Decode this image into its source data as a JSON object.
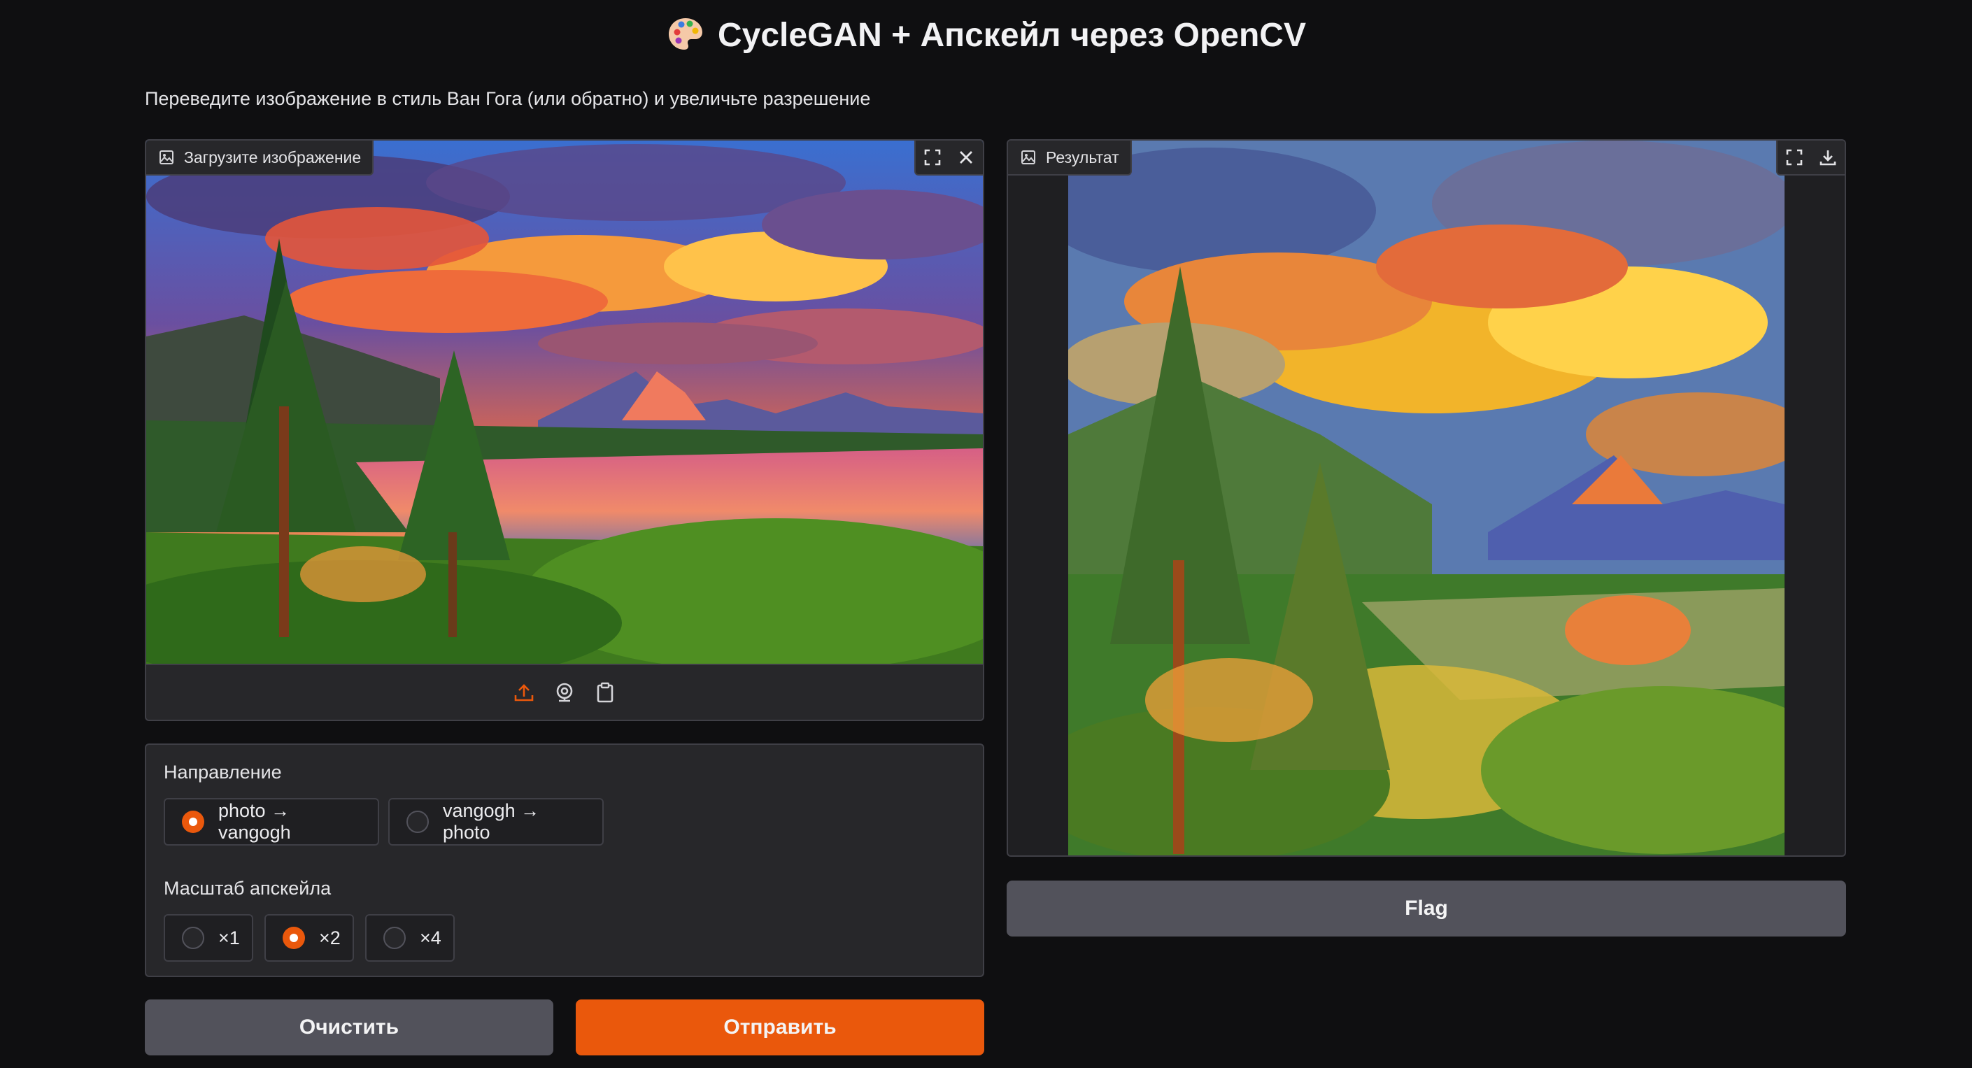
{
  "header": {
    "title": "CycleGAN + Апскейл через OpenCV",
    "emoji_icon": "palette-icon"
  },
  "description": "Переведите изображение в стиль Ван Гога (или обратно) и увеличьте разрешение",
  "input_image": {
    "label": "Загрузите изображение",
    "actions": [
      "fullscreen-icon",
      "close-icon"
    ],
    "sources": [
      "upload-icon",
      "webcam-icon",
      "clipboard-icon"
    ],
    "source_accent": "#ea580c"
  },
  "direction": {
    "title": "Направление",
    "options": [
      "photo → vangogh",
      "vangogh → photo"
    ],
    "selected": "photo → vangogh"
  },
  "upscale": {
    "title": "Масштаб апскейла",
    "options": [
      "×1",
      "×2",
      "×4"
    ],
    "selected": "×2"
  },
  "buttons": {
    "clear": "Очистить",
    "submit": "Отправить",
    "flag": "Flag"
  },
  "output_image": {
    "label": "Результат",
    "actions": [
      "fullscreen-icon",
      "download-icon"
    ]
  },
  "colors": {
    "accent": "#ea580c",
    "background": "#0f0f11",
    "panel": "#27272a",
    "button_gray": "#52525b"
  }
}
